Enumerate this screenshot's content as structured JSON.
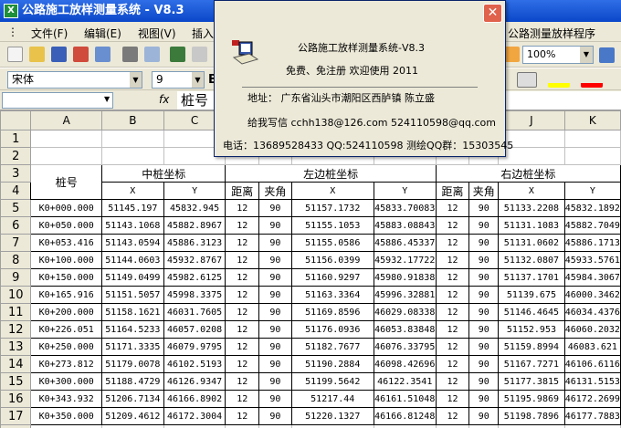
{
  "window": {
    "title": "公路施工放样测量系统 - V8.3"
  },
  "menu": {
    "items": [
      "文件(F)",
      "编辑(E)",
      "视图(V)",
      "插入"
    ],
    "right_title": "公路测量放样程序"
  },
  "toolbar": {
    "zoom": "100%"
  },
  "format": {
    "font": "宋体",
    "size": "9",
    "bold": "B"
  },
  "formula": {
    "fx": "fx",
    "value": "桩号"
  },
  "grid": {
    "columns": [
      "A",
      "B",
      "C",
      "D",
      "E",
      "F",
      "G",
      "H",
      "I",
      "J",
      "K"
    ],
    "rows": [
      "1",
      "2",
      "3",
      "4",
      "5",
      "6",
      "7",
      "8",
      "9",
      "10",
      "11",
      "12",
      "13",
      "14",
      "15",
      "16",
      "17",
      "18"
    ],
    "header": {
      "zh": "桩号",
      "mid": "中桩坐标",
      "left": "左边桩坐标",
      "right": "右边桩坐标",
      "x": "X",
      "y": "Y",
      "dist": "距离",
      "angle": "夹角"
    },
    "data": [
      [
        "K0+000.000",
        "51145.197",
        "45832.945",
        "12",
        "90",
        "51157.1732",
        "45833.70083",
        "12",
        "90",
        "51133.2208",
        "45832.1892"
      ],
      [
        "K0+050.000",
        "51143.1068",
        "45882.8967",
        "12",
        "90",
        "51155.1053",
        "45883.08843",
        "12",
        "90",
        "51131.1083",
        "45882.7049"
      ],
      [
        "K0+053.416",
        "51143.0594",
        "45886.3123",
        "12",
        "90",
        "51155.0586",
        "45886.45337",
        "12",
        "90",
        "51131.0602",
        "45886.1713"
      ],
      [
        "K0+100.000",
        "51144.0603",
        "45932.8767",
        "12",
        "90",
        "51156.0399",
        "45932.17722",
        "12",
        "90",
        "51132.0807",
        "45933.5761"
      ],
      [
        "K0+150.000",
        "51149.0499",
        "45982.6125",
        "12",
        "90",
        "51160.9297",
        "45980.91838",
        "12",
        "90",
        "51137.1701",
        "45984.3067"
      ],
      [
        "K0+165.916",
        "51151.5057",
        "45998.3375",
        "12",
        "90",
        "51163.3364",
        "45996.32881",
        "12",
        "90",
        "51139.675",
        "46000.3462"
      ],
      [
        "K0+200.000",
        "51158.1621",
        "46031.7605",
        "12",
        "90",
        "51169.8596",
        "46029.08338",
        "12",
        "90",
        "51146.4645",
        "46034.4376"
      ],
      [
        "K0+226.051",
        "51164.5233",
        "46057.0208",
        "12",
        "90",
        "51176.0936",
        "46053.83848",
        "12",
        "90",
        "51152.953",
        "46060.2032"
      ],
      [
        "K0+250.000",
        "51171.3335",
        "46079.9795",
        "12",
        "90",
        "51182.7677",
        "46076.33795",
        "12",
        "90",
        "51159.8994",
        "46083.621"
      ],
      [
        "K0+273.812",
        "51179.0078",
        "46102.5193",
        "12",
        "90",
        "51190.2884",
        "46098.42696",
        "12",
        "90",
        "51167.7271",
        "46106.6116"
      ],
      [
        "K0+300.000",
        "51188.4729",
        "46126.9347",
        "12",
        "90",
        "51199.5642",
        "46122.3541",
        "12",
        "90",
        "51177.3815",
        "46131.5153"
      ],
      [
        "K0+343.932",
        "51206.7134",
        "46166.8902",
        "12",
        "90",
        "51217.44",
        "46161.51048",
        "12",
        "90",
        "51195.9869",
        "46172.2699"
      ],
      [
        "K0+350.000",
        "51209.4612",
        "46172.3004",
        "12",
        "90",
        "51220.1327",
        "46166.81248",
        "12",
        "90",
        "51198.7896",
        "46177.7883"
      ]
    ]
  },
  "dialog": {
    "title": "公路施工放样测量系统-V8.3",
    "subtitle": "免费、免注册  欢迎使用  2011",
    "address": "地址：  广东省汕头市潮阳区西胪镇  陈立盛",
    "email": "给我写信  cchh138@126.com    524110598@qq.com",
    "contact": "电话：13689528433 QQ:524110598 测绘QQ群：15303545",
    "close": "✕"
  }
}
